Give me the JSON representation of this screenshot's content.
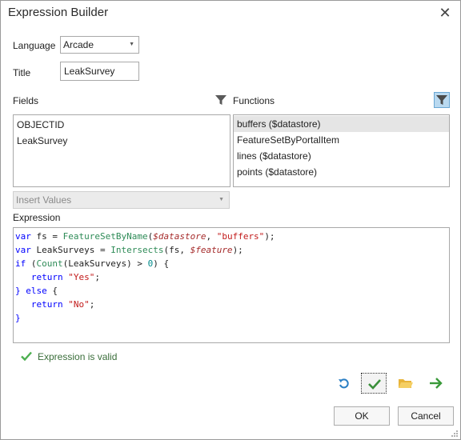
{
  "window": {
    "title": "Expression Builder",
    "close_glyph": "✕"
  },
  "language": {
    "label": "Language",
    "value": "Arcade"
  },
  "title_field": {
    "label": "Title",
    "value": "LeakSurvey"
  },
  "fields": {
    "label": "Fields",
    "items": [
      "OBJECTID",
      "LeakSurvey"
    ]
  },
  "functions": {
    "label": "Functions",
    "items": [
      "buffers ($datastore)",
      "FeatureSetByPortalItem",
      "lines ($datastore)",
      "points ($datastore)"
    ],
    "selected_index": 0
  },
  "insert_values": {
    "value": "Insert Values"
  },
  "expression": {
    "label": "Expression",
    "lines": [
      [
        [
          "kw",
          "var"
        ],
        [
          "plain",
          " fs = "
        ],
        [
          "fn",
          "FeatureSetByName"
        ],
        [
          "plain",
          "("
        ],
        [
          "var",
          "$datastore"
        ],
        [
          "plain",
          ", "
        ],
        [
          "str",
          "\"buffers\""
        ],
        [
          "plain",
          ");"
        ]
      ],
      [
        [
          "kw",
          "var"
        ],
        [
          "plain",
          " LeakSurveys = "
        ],
        [
          "fn",
          "Intersects"
        ],
        [
          "plain",
          "(fs, "
        ],
        [
          "var",
          "$feature"
        ],
        [
          "plain",
          ");"
        ]
      ],
      [
        [
          "kw",
          "if"
        ],
        [
          "plain",
          " ("
        ],
        [
          "fn",
          "Count"
        ],
        [
          "plain",
          "(LeakSurveys) > "
        ],
        [
          "num",
          "0"
        ],
        [
          "plain",
          ") {"
        ]
      ],
      [
        [
          "plain",
          "   "
        ],
        [
          "kw",
          "return"
        ],
        [
          "plain",
          " "
        ],
        [
          "str",
          "\"Yes\""
        ],
        [
          "plain",
          ";"
        ]
      ],
      [
        [
          "kw",
          "}"
        ],
        [
          "plain",
          " "
        ],
        [
          "kw",
          "else"
        ],
        [
          "plain",
          " {"
        ]
      ],
      [
        [
          "plain",
          "   "
        ],
        [
          "kw",
          "return"
        ],
        [
          "plain",
          " "
        ],
        [
          "str",
          "\"No\""
        ],
        [
          "plain",
          ";"
        ]
      ],
      [
        [
          "kw",
          "}"
        ]
      ]
    ]
  },
  "status": {
    "text": "Expression is valid",
    "color": "#4caf50"
  },
  "buttons": {
    "ok": "OK",
    "cancel": "Cancel"
  },
  "icons": {
    "undo": "undo-icon",
    "verify": "check-icon",
    "open": "folder-icon",
    "run": "arrow-right-icon",
    "filter": "filter-icon"
  },
  "colors": {
    "accent": "#2a7fc4",
    "active_filter_bg": "#b9d9f0",
    "check_green": "#4caf50",
    "folder_yellow": "#e8b43a"
  }
}
